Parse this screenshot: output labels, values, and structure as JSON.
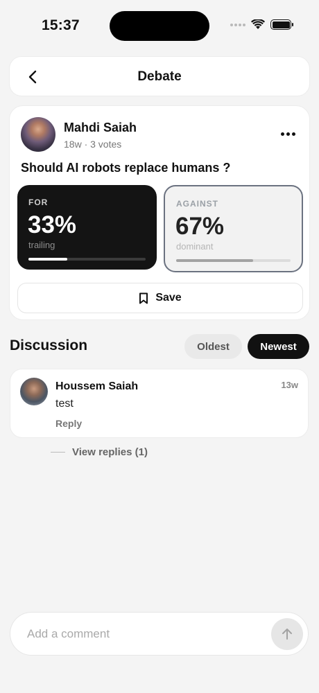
{
  "status_bar": {
    "time": "15:37"
  },
  "header": {
    "title": "Debate"
  },
  "post": {
    "author": "Mahdi Saiah",
    "meta": "18w · 3 votes",
    "question": "Should AI robots replace humans ?",
    "for": {
      "label": "FOR",
      "percent": "33%",
      "status": "trailing",
      "fraction": 0.33
    },
    "against": {
      "label": "AGAINST",
      "percent": "67%",
      "status": "dominant",
      "fraction": 0.67
    },
    "save_label": "Save"
  },
  "discussion": {
    "title": "Discussion",
    "sort_oldest": "Oldest",
    "sort_newest": "Newest",
    "selected_sort": "Newest",
    "comments": [
      {
        "author": "Houssem Saiah",
        "time": "13w",
        "text": "test",
        "reply_label": "Reply"
      }
    ],
    "view_replies": "View replies (1)"
  },
  "composer": {
    "placeholder": "Add a comment"
  },
  "colors": {
    "accent": "#111111",
    "background": "#f4f4f4",
    "against_border": "#6b7280"
  }
}
